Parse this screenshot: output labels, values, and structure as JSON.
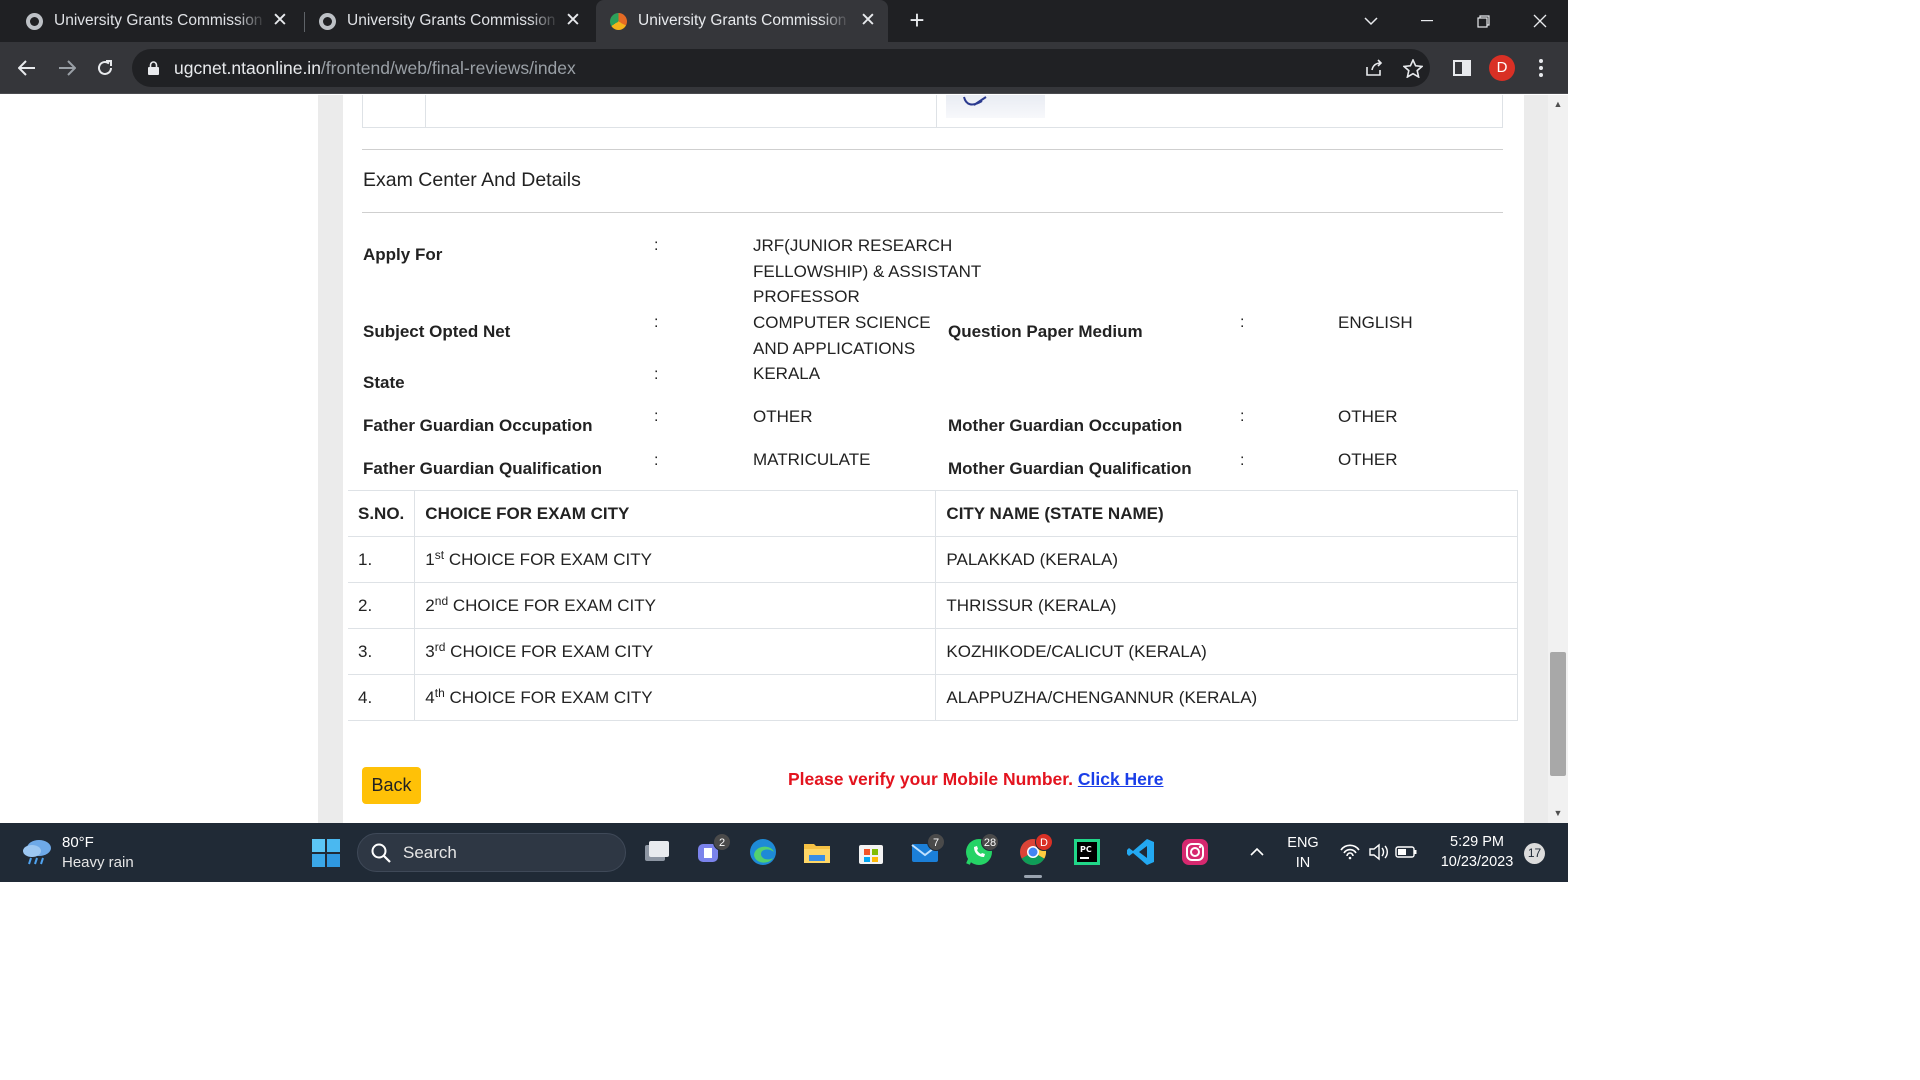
{
  "browser": {
    "tabs": [
      {
        "title": "University Grants Commission (UGC)",
        "icon": "globe-icon"
      },
      {
        "title": "University Grants Commission (UGC)",
        "icon": "globe-icon"
      },
      {
        "title": "University Grants Commission (UGC)",
        "icon": "nta-favicon",
        "active": true
      }
    ],
    "url_host": "ugcnet.ntaonline.in",
    "url_path": "/frontend/web/final-reviews/index",
    "profile_initial": "D"
  },
  "section": {
    "title": "Exam Center And Details"
  },
  "details": {
    "apply_for": {
      "label": "Apply For",
      "value_lines": [
        "JRF(JUNIOR RESEARCH",
        "FELLOWSHIP) & ASSISTANT",
        "PROFESSOR"
      ]
    },
    "subject": {
      "label": "Subject Opted Net",
      "value_lines": [
        "COMPUTER SCIENCE",
        "AND APPLICATIONS"
      ]
    },
    "medium": {
      "label": "Question Paper Medium",
      "value": "ENGLISH"
    },
    "state": {
      "label": "State",
      "value": "KERALA"
    },
    "father_occupation": {
      "label": "Father Guardian Occupation",
      "value": "OTHER"
    },
    "mother_occupation": {
      "label": "Mother Guardian Occupation",
      "value": "OTHER"
    },
    "father_qualification": {
      "label": "Father Guardian Qualification",
      "value": "MATRICULATE"
    },
    "mother_qualification": {
      "label": "Mother Guardian Qualification",
      "value": "OTHER"
    },
    "colon": ":"
  },
  "city_table": {
    "headers": [
      "S.NO.",
      "CHOICE FOR EXAM CITY",
      "CITY NAME (STATE NAME)"
    ],
    "rows": [
      {
        "sno": "1.",
        "num": "1",
        "sup": "st",
        "choice": "CHOICE FOR EXAM CITY",
        "city": "PALAKKAD (KERALA)"
      },
      {
        "sno": "2.",
        "num": "2",
        "sup": "nd",
        "choice": "CHOICE FOR EXAM CITY",
        "city": "THRISSUR (KERALA)"
      },
      {
        "sno": "3.",
        "num": "3",
        "sup": "rd",
        "choice": "CHOICE FOR EXAM CITY",
        "city": "KOZHIKODE/CALICUT (KERALA)"
      },
      {
        "sno": "4.",
        "num": "4",
        "sup": "th",
        "choice": "CHOICE FOR EXAM CITY",
        "city": "ALAPPUZHA/CHENGANNUR (KERALA)"
      }
    ]
  },
  "actions": {
    "back_label": "Back",
    "verify_text": "Please verify your Mobile Number.",
    "verify_link": "Click Here"
  },
  "taskbar": {
    "weather_temp": "80°F",
    "weather_desc": "Heavy rain",
    "search_placeholder": "Search",
    "badges": {
      "teams": "2",
      "mail": "7",
      "whatsapp": "28",
      "chrome": "D"
    },
    "lang_top": "ENG",
    "lang_bottom": "IN",
    "time": "5:29 PM",
    "date": "10/23/2023",
    "notifications": "17"
  },
  "colors": {
    "accent_button": "#ffc107",
    "verify_red": "#e3131e",
    "link_blue": "#1a3ee8"
  }
}
